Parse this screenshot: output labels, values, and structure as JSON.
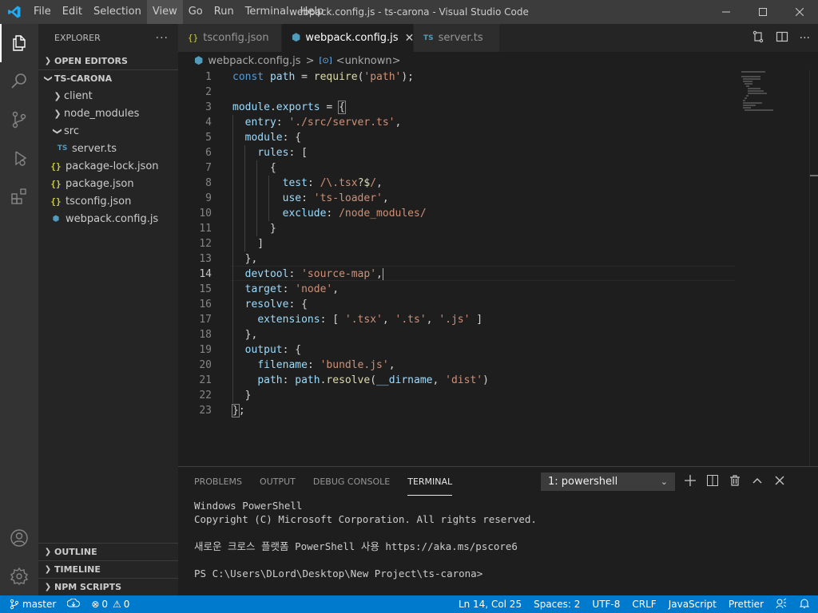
{
  "window": {
    "title": "webpack.config.js - ts-carona - Visual Studio Code",
    "menu": [
      "File",
      "Edit",
      "Selection",
      "View",
      "Go",
      "Run",
      "Terminal",
      "Help"
    ],
    "active_menu": "View"
  },
  "sidebar": {
    "header": "EXPLORER",
    "more": "···",
    "open_editors": "OPEN EDITORS",
    "project": "TS-CARONA",
    "tree": [
      {
        "label": "client",
        "type": "folder",
        "twist": "›"
      },
      {
        "label": "node_modules",
        "type": "folder",
        "twist": "›"
      },
      {
        "label": "src",
        "type": "folder",
        "twist": "⌄"
      },
      {
        "label": "server.ts",
        "type": "ts",
        "icon": "TS"
      },
      {
        "label": "package-lock.json",
        "type": "json",
        "icon": "{}"
      },
      {
        "label": "package.json",
        "type": "json",
        "icon": "{}"
      },
      {
        "label": "tsconfig.json",
        "type": "json",
        "icon": "{}"
      },
      {
        "label": "webpack.config.js",
        "type": "webpack",
        "icon": "⬢"
      }
    ],
    "outline": "OUTLINE",
    "timeline": "TIMELINE",
    "npm_scripts": "NPM SCRIPTS"
  },
  "tabs": [
    {
      "label": "tsconfig.json",
      "icon": "{}",
      "active": false
    },
    {
      "label": "webpack.config.js",
      "icon": "⬢",
      "active": true,
      "close": "✕"
    },
    {
      "label": "server.ts",
      "icon": "TS",
      "active": false
    }
  ],
  "breadcrumb": {
    "file": "webpack.config.js",
    "sep": ">",
    "symbol_icon": "[⊙]",
    "symbol": "<unknown>"
  },
  "code": {
    "current_line": 14,
    "lines": [
      "1",
      "2",
      "3",
      "4",
      "5",
      "6",
      "7",
      "8",
      "9",
      "10",
      "11",
      "12",
      "13",
      "14",
      "15",
      "16",
      "17",
      "18",
      "19",
      "20",
      "21",
      "22",
      "23"
    ]
  },
  "panel": {
    "tabs": [
      "PROBLEMS",
      "OUTPUT",
      "DEBUG CONSOLE",
      "TERMINAL"
    ],
    "active_tab": "TERMINAL",
    "terminal_select": "1: powershell",
    "terminal_text": "Windows PowerShell\nCopyright (C) Microsoft Corporation. All rights reserved.\n\n새로운 크로스 플랫폼 PowerShell 사용 https://aka.ms/pscore6\n\nPS C:\\Users\\DLord\\Desktop\\New Project\\ts-carona>"
  },
  "statusbar": {
    "branch": "master",
    "errors": "0",
    "warnings": "0",
    "position": "Ln 14, Col 25",
    "spaces": "Spaces: 2",
    "encoding": "UTF-8",
    "eol": "CRLF",
    "language": "JavaScript",
    "formatter": "Prettier"
  },
  "colors": {
    "accent": "#007acc",
    "titlebar": "#3c3c3c",
    "sidebar": "#252526",
    "editor": "#1e1e1e",
    "keyword": "#569cd6",
    "string": "#ce9178",
    "property": "#9cdcfe",
    "function": "#dcdcaa"
  }
}
